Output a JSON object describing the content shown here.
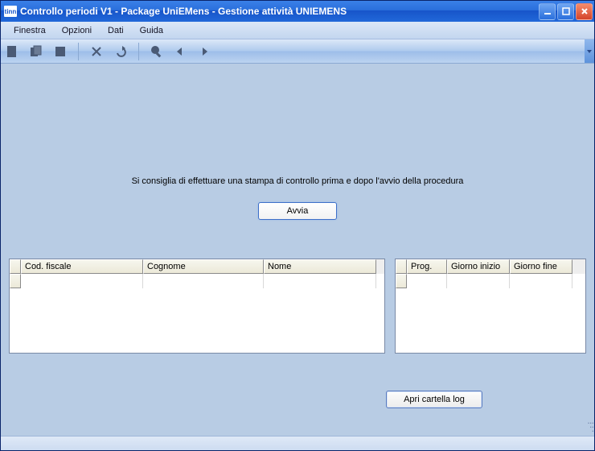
{
  "window": {
    "app_prefix": "tinn",
    "title": "Controllo periodi V1  - Package UniEMens - Gestione attività UNIEMENS"
  },
  "menu": {
    "items": [
      "Finestra",
      "Opzioni",
      "Dati",
      "Guida"
    ]
  },
  "toolbar": {
    "icons": [
      "new-icon",
      "copy-icon",
      "stop-icon",
      "cut-icon",
      "undo-icon",
      "zoom-icon",
      "back-icon",
      "forward-icon"
    ]
  },
  "main": {
    "hint": "Si consiglia di effettuare una stampa di controllo prima e dopo l'avvio della procedura",
    "start_button": "Avvia"
  },
  "grid_left": {
    "columns": [
      "Cod. fiscale",
      "Cognome",
      "Nome"
    ],
    "rows": []
  },
  "grid_right": {
    "columns": [
      "Prog.",
      "Giorno inizio",
      "Giorno fine"
    ],
    "rows": []
  },
  "footer": {
    "open_log": "Apri cartella log"
  }
}
